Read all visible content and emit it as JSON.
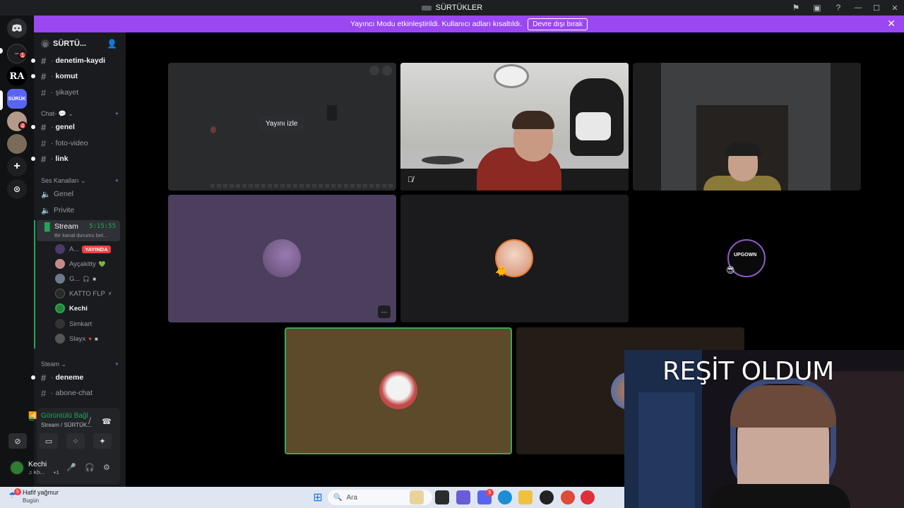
{
  "window": {
    "title": "SÜRTÜKLER",
    "colors": {
      "brand": "#5865f2",
      "notice": "#9b47f2",
      "online": "#23a55a",
      "live": "#f23f42"
    }
  },
  "notice": {
    "text": "Yayıncı Modu etkinleştirildi. Kullanıcı adları kısaltıldı.",
    "button": "Devre dışı bırak"
  },
  "rail": {
    "servers": [
      {
        "label": "RA"
      },
      {
        "label": "SÜRÜK"
      }
    ],
    "badges": [
      "1",
      "4"
    ]
  },
  "server": {
    "name": "SÜRTÜ..."
  },
  "channels": {
    "top": [
      {
        "name": "denetim-kaydi",
        "unread": true
      },
      {
        "name": "komut",
        "unread": true
      },
      {
        "name": "şikayet",
        "unread": false
      }
    ],
    "chat_category": "Chat-",
    "chat": [
      {
        "name": "genel",
        "unread": true
      },
      {
        "name": "foto-video",
        "unread": false
      },
      {
        "name": "link",
        "unread": true
      }
    ],
    "voice_category": "Ses Kanalları",
    "voice": [
      {
        "name": "Genel"
      },
      {
        "name": "Privite"
      }
    ],
    "stream": {
      "name": "Stream",
      "time": "5:15:55",
      "status": "Bir kanal durumu bel..."
    },
    "members": [
      {
        "name": "A...",
        "live": "YAYINDA",
        "color": "#4a3a6a"
      },
      {
        "name": "Ayçakitty",
        "color": "#c58b8b"
      },
      {
        "name": "G...",
        "color": "#6b7b8b"
      },
      {
        "name": "KATTO FLP",
        "color": "#2a2a2a"
      },
      {
        "name": "Kechi",
        "color": "#2e7d32"
      },
      {
        "name": "Simkart",
        "color": "#333"
      },
      {
        "name": "Slayx",
        "color": "#555"
      }
    ],
    "steam_category": "Steam",
    "steam": [
      {
        "name": "deneme",
        "unread": true
      },
      {
        "name": "abone-chat",
        "unread": false
      }
    ]
  },
  "voice_panel": {
    "status": "Görüntülü Bağl",
    "channel": "Stream / SÜRTÜK..."
  },
  "user": {
    "name": "Kechi",
    "status": "Kh...",
    "extra": "+1"
  },
  "stage": {
    "watch_label": "Yayını izle",
    "more_label": "···"
  },
  "pip": {
    "caption": "REŞİT OLDUM"
  },
  "taskbar": {
    "weather_title": "Hafif yağmur",
    "weather_sub": "Bugün",
    "search_placeholder": "Ara",
    "discord_badge": "5"
  }
}
